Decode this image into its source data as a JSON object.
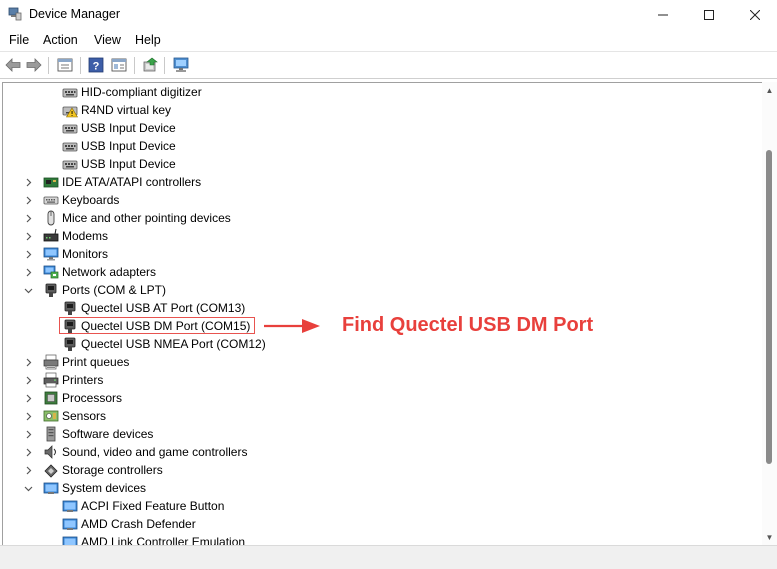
{
  "window": {
    "title": "Device Manager",
    "controls": {
      "minimize_icon": "minimize-icon",
      "maximize_icon": "maximize-icon",
      "close_icon": "close-icon"
    }
  },
  "menu": [
    "File",
    "Action",
    "View",
    "Help"
  ],
  "toolbar": {
    "buttons": [
      "back-icon",
      "forward-icon",
      "properties-sheet-icon",
      "help-icon",
      "details-icon",
      "update-driver-icon",
      "scan-hardware-icon"
    ]
  },
  "tree": [
    {
      "label": "HID-compliant digitizer",
      "level": 2,
      "icon": "hid-device-icon"
    },
    {
      "label": "R4ND virtual key",
      "level": 2,
      "icon": "hid-warning-icon"
    },
    {
      "label": "USB Input Device",
      "level": 2,
      "icon": "hid-device-icon"
    },
    {
      "label": "USB Input Device",
      "level": 2,
      "icon": "hid-device-icon"
    },
    {
      "label": "USB Input Device",
      "level": 2,
      "icon": "hid-device-icon"
    },
    {
      "label": "IDE ATA/ATAPI controllers",
      "level": 1,
      "icon": "ide-controller-icon",
      "state": "collapsed"
    },
    {
      "label": "Keyboards",
      "level": 1,
      "icon": "keyboard-icon",
      "state": "collapsed"
    },
    {
      "label": "Mice and other pointing devices",
      "level": 1,
      "icon": "mouse-icon",
      "state": "collapsed"
    },
    {
      "label": "Modems",
      "level": 1,
      "icon": "modem-icon",
      "state": "collapsed"
    },
    {
      "label": "Monitors",
      "level": 1,
      "icon": "monitor-icon",
      "state": "collapsed"
    },
    {
      "label": "Network adapters",
      "level": 1,
      "icon": "network-adapter-icon",
      "state": "collapsed"
    },
    {
      "label": "Ports (COM & LPT)",
      "level": 1,
      "icon": "port-icon",
      "state": "expanded"
    },
    {
      "label": "Quectel USB AT Port (COM13)",
      "level": 2,
      "icon": "port-icon"
    },
    {
      "label": "Quectel USB DM Port (COM15)",
      "level": 2,
      "icon": "port-icon",
      "highlighted": true
    },
    {
      "label": "Quectel USB NMEA Port (COM12)",
      "level": 2,
      "icon": "port-icon"
    },
    {
      "label": "Print queues",
      "level": 1,
      "icon": "print-queue-icon",
      "state": "collapsed"
    },
    {
      "label": "Printers",
      "level": 1,
      "icon": "printer-icon",
      "state": "collapsed"
    },
    {
      "label": "Processors",
      "level": 1,
      "icon": "processor-icon",
      "state": "collapsed"
    },
    {
      "label": "Sensors",
      "level": 1,
      "icon": "sensor-icon",
      "state": "collapsed"
    },
    {
      "label": "Software devices",
      "level": 1,
      "icon": "software-device-icon",
      "state": "collapsed"
    },
    {
      "label": "Sound, video and game controllers",
      "level": 1,
      "icon": "sound-icon",
      "state": "collapsed"
    },
    {
      "label": "Storage controllers",
      "level": 1,
      "icon": "storage-controller-icon",
      "state": "collapsed"
    },
    {
      "label": "System devices",
      "level": 1,
      "icon": "system-device-icon",
      "state": "expanded"
    },
    {
      "label": "ACPI Fixed Feature Button",
      "level": 2,
      "icon": "system-device-icon"
    },
    {
      "label": "AMD Crash Defender",
      "level": 2,
      "icon": "system-device-icon"
    },
    {
      "label": "AMD Link Controller Emulation",
      "level": 2,
      "icon": "system-device-icon"
    }
  ],
  "annotation": {
    "text": "Find Quectel USB DM Port",
    "color": "#e8403c"
  }
}
